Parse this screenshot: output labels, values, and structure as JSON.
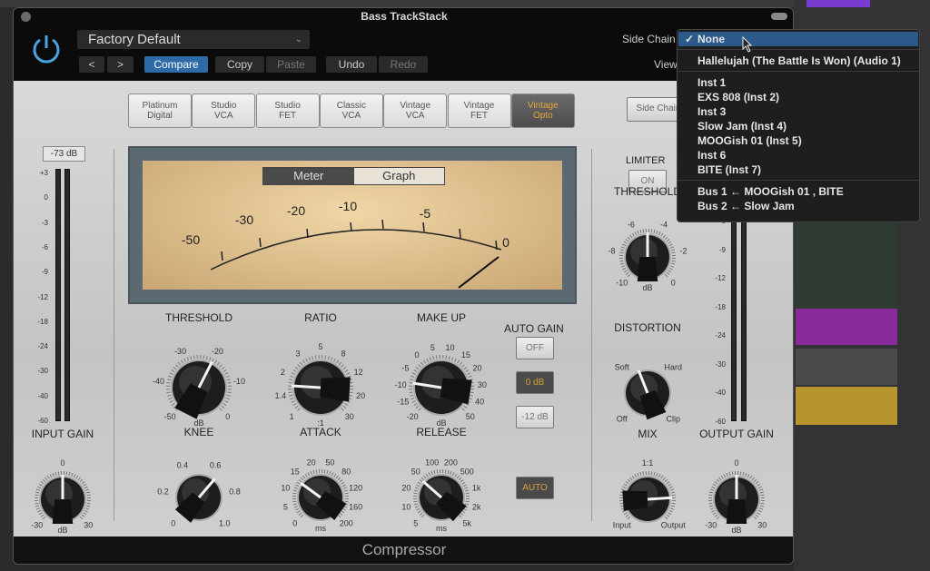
{
  "window": {
    "title": "Bass TrackStack",
    "plugin_name": "Compressor"
  },
  "header": {
    "preset": "Factory Default",
    "prev": "<",
    "next": ">",
    "compare": "Compare",
    "copy": "Copy",
    "paste": "Paste",
    "undo": "Undo",
    "redo": "Redo",
    "side_chain_label": "Side Chain",
    "view_label": "View",
    "power_on": true
  },
  "colors": {
    "accent": "#2d6aa6",
    "power": "#4aa3e0",
    "selected_model_text": "#e7a73a",
    "menu_highlight": "#2b5a8a"
  },
  "sidechain_menu": {
    "selected": "None",
    "groups": [
      [
        "None"
      ],
      [
        "Hallelujah (The Battle Is Won) (Audio 1)"
      ],
      [
        "Inst 1",
        "EXS 808 (Inst 2)",
        "Inst 3",
        "Slow Jam (Inst 4)",
        "MOOGish 01 (Inst 5)",
        "Inst 6",
        "BITE (Inst 7)"
      ],
      [
        "Bus 1 ← MOOGish 01 , BITE",
        "Bus 2 ← Slow Jam"
      ]
    ]
  },
  "models": [
    {
      "label": "Platinum\nDigital"
    },
    {
      "label": "Studio\nVCA"
    },
    {
      "label": "Studio\nFET"
    },
    {
      "label": "Classic\nVCA"
    },
    {
      "label": "Vintage\nVCA"
    },
    {
      "label": "Vintage\nFET"
    },
    {
      "label": "Vintage\nOpto",
      "selected": true
    }
  ],
  "side_chain_button": "Side Chain",
  "input_meter": {
    "peak": "-73 dB",
    "scale": [
      "+3",
      "0",
      "-3",
      "-6",
      "-9",
      "-12",
      "-18",
      "-24",
      "-30",
      "-40",
      "-60"
    ]
  },
  "output_meter": {
    "scale": [
      "-6",
      "-9",
      "-12",
      "-18",
      "-24",
      "-30",
      "-40",
      "-60"
    ]
  },
  "vu": {
    "tabs": [
      "Meter",
      "Graph"
    ],
    "active_tab": "Meter",
    "scale": [
      "-50",
      "-30",
      "-20",
      "-10",
      "-5",
      "0"
    ]
  },
  "auto_gain": {
    "label": "AUTO GAIN",
    "buttons": [
      "OFF",
      "0 dB",
      "-12 dB"
    ],
    "selected": "0 dB",
    "auto": "AUTO",
    "auto_on": true
  },
  "limiter": {
    "label": "LIMITER",
    "on": "ON"
  },
  "knobs": {
    "threshold": {
      "label": "THRESHOLD",
      "unit": "dB",
      "scale": [
        "-50",
        "-40",
        "-30",
        "-20",
        "-10",
        "0"
      ],
      "position": 0.6
    },
    "ratio": {
      "label": "RATIO",
      "unit": ":1",
      "scale": [
        "1",
        "1.4",
        "2",
        "3",
        "5",
        "8",
        "12",
        "20",
        "30"
      ],
      "position": 0.18
    },
    "makeup": {
      "label": "MAKE UP",
      "unit": "dB",
      "scale": [
        "-20",
        "-15",
        "-10",
        "-5",
        "0",
        "5",
        "10",
        "15",
        "20",
        "30",
        "40",
        "50"
      ],
      "position": 0.2
    },
    "knee": {
      "label": "KNEE",
      "unit": "",
      "scale": [
        "0",
        "0.2",
        "0.4",
        "0.6",
        "0.8",
        "1.0"
      ],
      "position": 0.65
    },
    "attack": {
      "label": "ATTACK",
      "unit": "ms",
      "scale": [
        "0",
        "5",
        "10",
        "15",
        "20",
        "50",
        "80",
        "120",
        "160",
        "200"
      ],
      "position": 0.3
    },
    "release": {
      "label": "RELEASE",
      "unit": "ms",
      "scale": [
        "5",
        "10",
        "20",
        "50",
        "100",
        "200",
        "500",
        "1k",
        "2k",
        "5k"
      ],
      "position": 0.32
    },
    "input_gain": {
      "label": "INPUT GAIN",
      "unit": "dB",
      "scale": [
        "-30",
        "0",
        "30"
      ],
      "position": 0.5
    },
    "limiter_threshold": {
      "label": "THRESHOLD",
      "unit": "dB",
      "scale": [
        "-10",
        "-8",
        "-6",
        "-4",
        "-2",
        "0"
      ],
      "position": 0.5
    },
    "distortion": {
      "label": "DISTORTION",
      "unit": "",
      "scale": [
        "Off",
        "Soft",
        "Hard",
        "Clip"
      ],
      "position": 0.42
    },
    "mix": {
      "label": "MIX",
      "unit": "",
      "scale": [
        "Input",
        "1:1",
        "Output"
      ],
      "position": 0.82
    },
    "output_gain": {
      "label": "OUTPUT GAIN",
      "unit": "dB",
      "scale": [
        "-30",
        "0",
        "30"
      ],
      "position": 0.5
    }
  }
}
